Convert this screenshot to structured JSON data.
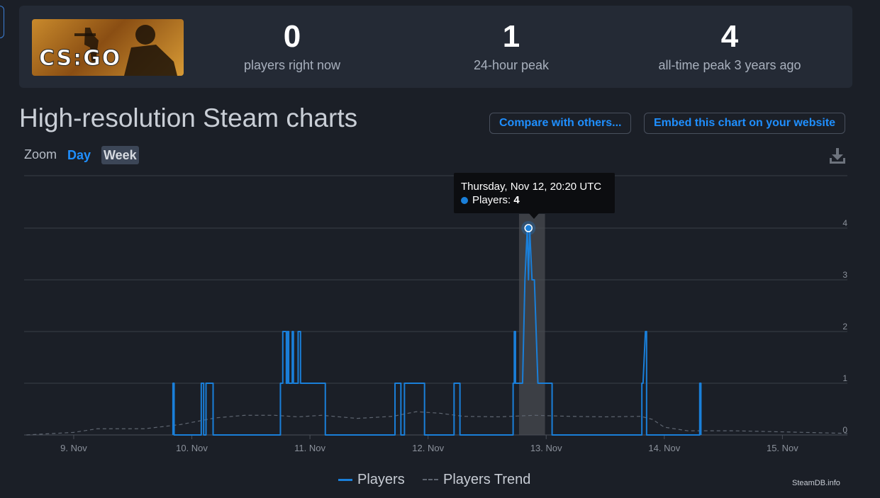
{
  "stats": {
    "logo_text": "CS:GO",
    "current": {
      "value": "0",
      "label": "players right now"
    },
    "peak24": {
      "value": "1",
      "label": "24-hour peak"
    },
    "alltime": {
      "value": "4",
      "label": "all-time peak 3 years ago"
    }
  },
  "page_title": "High-resolution Steam charts",
  "buttons": {
    "compare": "Compare with others...",
    "embed": "Embed this chart on your website"
  },
  "zoom": {
    "label": "Zoom",
    "options": [
      "Day",
      "Week"
    ],
    "selected": "Week"
  },
  "icons": {
    "download": "download-icon"
  },
  "colors": {
    "players": "#1a7fd9",
    "trend": "#5e6570",
    "accent": "#1f8fff"
  },
  "tooltip": {
    "date": "Thursday, Nov 12, 20:20 UTC",
    "series_label": "Players: ",
    "value": "4"
  },
  "credit": "SteamDB.info",
  "chart_data": {
    "type": "line",
    "x_unit": "days in November (UTC)",
    "xlim": [
      8.58,
      15.55
    ],
    "ylim": [
      0,
      4
    ],
    "y_ticks": [
      "0",
      "1",
      "2",
      "3",
      "4"
    ],
    "x_ticks": [
      {
        "value": 9,
        "label": "9. Nov"
      },
      {
        "value": 10,
        "label": "10. Nov"
      },
      {
        "value": 11,
        "label": "11. Nov"
      },
      {
        "value": 12,
        "label": "12. Nov"
      },
      {
        "value": 13,
        "label": "13. Nov"
      },
      {
        "value": 14,
        "label": "14. Nov"
      },
      {
        "value": 15,
        "label": "15. Nov"
      }
    ],
    "grid": true,
    "legend_position": "bottom",
    "highlight": {
      "x": 12.85,
      "y": 4,
      "band": [
        12.77,
        12.99
      ]
    },
    "series": [
      {
        "name": "Players",
        "points": [
          [
            9.84,
            0
          ],
          [
            9.84,
            1
          ],
          [
            9.85,
            1
          ],
          [
            9.85,
            0
          ],
          [
            10.08,
            0
          ],
          [
            10.08,
            1
          ],
          [
            10.1,
            1
          ],
          [
            10.1,
            0
          ],
          [
            10.12,
            0
          ],
          [
            10.12,
            1
          ],
          [
            10.18,
            1
          ],
          [
            10.18,
            0
          ],
          [
            10.75,
            0
          ],
          [
            10.75,
            1
          ],
          [
            10.77,
            1
          ],
          [
            10.77,
            2
          ],
          [
            10.8,
            2
          ],
          [
            10.8,
            1
          ],
          [
            10.81,
            1
          ],
          [
            10.81,
            2
          ],
          [
            10.82,
            2
          ],
          [
            10.82,
            1
          ],
          [
            10.85,
            1
          ],
          [
            10.85,
            2
          ],
          [
            10.86,
            2
          ],
          [
            10.86,
            1
          ],
          [
            10.9,
            1
          ],
          [
            10.9,
            2
          ],
          [
            10.92,
            2
          ],
          [
            10.92,
            1
          ],
          [
            11.13,
            1
          ],
          [
            11.13,
            0
          ],
          [
            11.72,
            0
          ],
          [
            11.72,
            1
          ],
          [
            11.77,
            1
          ],
          [
            11.77,
            0
          ],
          [
            11.8,
            0
          ],
          [
            11.8,
            1
          ],
          [
            11.97,
            1
          ],
          [
            11.97,
            0
          ],
          [
            12.22,
            0
          ],
          [
            12.22,
            1
          ],
          [
            12.27,
            1
          ],
          [
            12.27,
            0
          ],
          [
            12.72,
            0
          ],
          [
            12.72,
            1
          ],
          [
            12.73,
            1
          ],
          [
            12.73,
            2
          ],
          [
            12.74,
            2
          ],
          [
            12.74,
            1
          ],
          [
            12.8,
            1
          ],
          [
            12.82,
            3
          ],
          [
            12.84,
            4
          ],
          [
            12.85,
            3
          ],
          [
            12.86,
            4
          ],
          [
            12.88,
            3
          ],
          [
            12.9,
            3
          ],
          [
            12.93,
            1
          ],
          [
            13.05,
            1
          ],
          [
            13.05,
            0
          ],
          [
            13.81,
            0
          ],
          [
            13.81,
            1
          ],
          [
            13.82,
            1
          ],
          [
            13.84,
            2
          ],
          [
            13.85,
            2
          ],
          [
            13.85,
            0
          ],
          [
            14.3,
            0
          ],
          [
            14.3,
            1
          ],
          [
            14.31,
            1
          ],
          [
            14.31,
            0
          ]
        ]
      },
      {
        "name": "Players Trend",
        "points": [
          [
            8.6,
            0
          ],
          [
            9.0,
            0.05
          ],
          [
            9.2,
            0.12
          ],
          [
            9.6,
            0.12
          ],
          [
            9.9,
            0.2
          ],
          [
            10.2,
            0.33
          ],
          [
            10.45,
            0.38
          ],
          [
            10.7,
            0.38
          ],
          [
            10.9,
            0.35
          ],
          [
            11.1,
            0.38
          ],
          [
            11.4,
            0.32
          ],
          [
            11.7,
            0.36
          ],
          [
            11.9,
            0.45
          ],
          [
            12.1,
            0.42
          ],
          [
            12.3,
            0.36
          ],
          [
            12.6,
            0.35
          ],
          [
            12.9,
            0.38
          ],
          [
            13.2,
            0.36
          ],
          [
            13.5,
            0.35
          ],
          [
            13.8,
            0.36
          ],
          [
            13.9,
            0.3
          ],
          [
            14.0,
            0.15
          ],
          [
            14.2,
            0.08
          ],
          [
            14.6,
            0.08
          ],
          [
            15.0,
            0.06
          ],
          [
            15.55,
            0.03
          ]
        ]
      }
    ]
  }
}
